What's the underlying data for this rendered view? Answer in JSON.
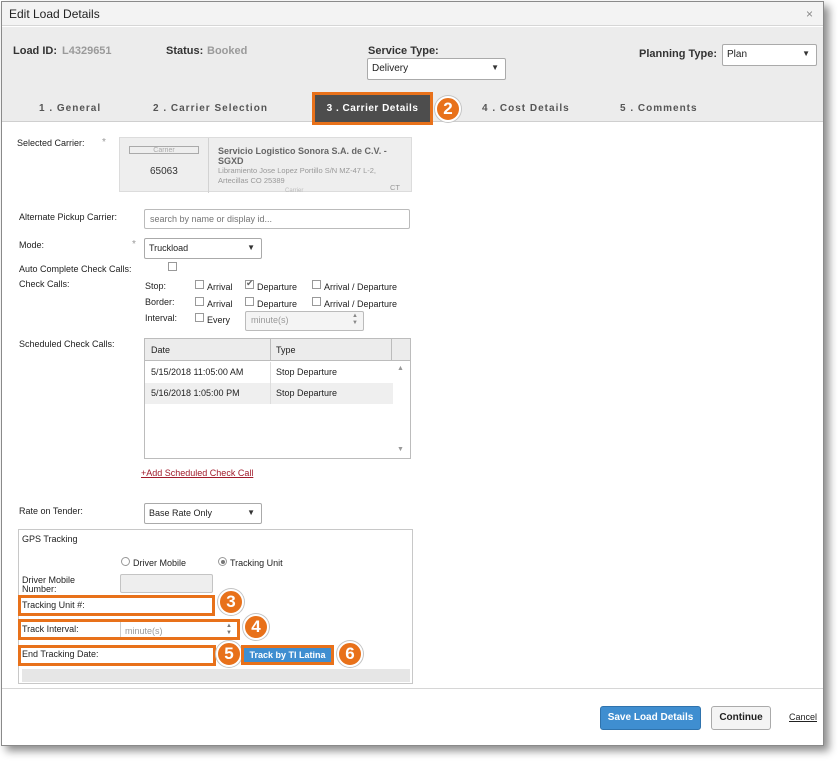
{
  "window": {
    "title": "Edit Load Details",
    "close_glyph": "×"
  },
  "header": {
    "load_id_label": "Load ID:",
    "load_id_value": "L4329651",
    "status_label": "Status:",
    "status_value": "Booked",
    "service_type_label": "Service Type:",
    "service_type_value": "Delivery",
    "planning_type_label": "Planning Type:",
    "planning_type_value": "Plan"
  },
  "tabs": [
    {
      "label": "1 . General"
    },
    {
      "label": "2 . Carrier Selection"
    },
    {
      "label": "3 . Carrier Details"
    },
    {
      "label": "4 . Cost Details"
    },
    {
      "label": "5 . Comments"
    }
  ],
  "badges": {
    "tab": "2",
    "tracking_unit": "3",
    "track_interval": "4",
    "end_tracking": "5",
    "track_button": "6"
  },
  "carrier": {
    "label": "Selected Carrier:",
    "required": "*",
    "tag": "Carrier",
    "id": "65063",
    "name": "Servicio Logistico Sonora S.A. de C.V. - SGXD",
    "address1": "Libramiento Jose Lopez Portillo S/N MZ-47 L-2,",
    "address2": "Artecillas CO 25389",
    "country": "CT",
    "footer_tag": "Carrier"
  },
  "alt_pickup": {
    "label": "Alternate Pickup Carrier:",
    "placeholder": "search by name or display id..."
  },
  "mode": {
    "label": "Mode:",
    "required": "*",
    "value": "Truckload"
  },
  "auto_complete": {
    "label": "Auto Complete Check Calls:"
  },
  "check_calls": {
    "label": "Check Calls:",
    "stop_label": "Stop:",
    "border_label": "Border:",
    "interval_label": "Interval:",
    "arrival": "Arrival",
    "departure": "Departure",
    "arrival_departure": "Arrival / Departure",
    "every": "Every",
    "unit_placeholder": "minute(s)"
  },
  "scheduled": {
    "label": "Scheduled Check Calls:",
    "col_date": "Date",
    "col_type": "Type",
    "rows": [
      {
        "date": "5/15/2018 11:05:00 AM",
        "type": "Stop Departure"
      },
      {
        "date": "5/16/2018 1:05:00 PM",
        "type": "Stop Departure"
      }
    ],
    "add_link": "+Add Scheduled Check Call"
  },
  "rate_on_tender": {
    "label": "Rate on Tender:",
    "value": "Base Rate Only"
  },
  "gps": {
    "title": "GPS Tracking",
    "driver_mobile": "Driver Mobile",
    "tracking_unit": "Tracking Unit",
    "driver_mobile_number_label": "Driver Mobile Number:",
    "tracking_unit_label": "Tracking Unit #:",
    "track_interval_label": "Track Interval:",
    "track_interval_placeholder": "minute(s)",
    "end_tracking_label": "End Tracking Date:",
    "track_button": "Track by TI Latina"
  },
  "footer": {
    "save": "Save Load Details",
    "continue": "Continue",
    "cancel": "Cancel"
  },
  "colors": {
    "accent_orange": "#e8711a",
    "primary_blue": "#3f8ed0",
    "active_tab": "#4d4d4d",
    "link_red": "#a01a2a"
  }
}
